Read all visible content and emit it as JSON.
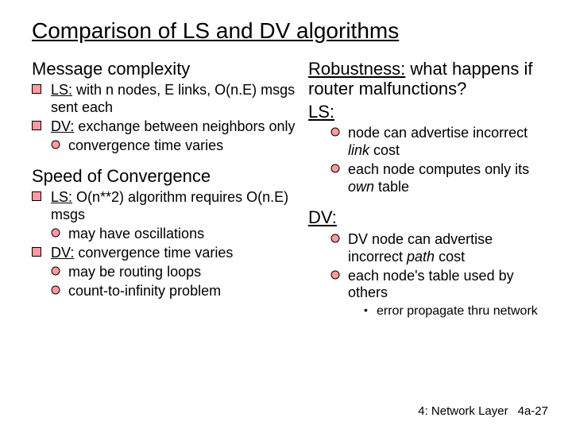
{
  "title": "Comparison of LS and DV algorithms",
  "left": {
    "h1": "Message complexity",
    "l1": {
      "prefix": "LS:",
      "rest": " with n nodes, E links, O(n.E) msgs sent each"
    },
    "l2": {
      "prefix": "DV:",
      "rest": " exchange between neighbors only"
    },
    "l2a": "convergence time varies",
    "h2": "Speed of Convergence",
    "l3": {
      "prefix": "LS:",
      "rest": " O(n**2) algorithm requires O(n.E) msgs"
    },
    "l3a": "may have oscillations",
    "l4": {
      "prefix": "DV:",
      "rest": " convergence time varies"
    },
    "l4a": "may be routing loops",
    "l4b": "count-to-infinity problem"
  },
  "right": {
    "h1a": "Robustness:",
    "h1b": " what happens if router malfunctions?",
    "ls_label": "LS:",
    "ls1a": "node can advertise incorrect ",
    "ls1b": "link",
    "ls1c": " cost",
    "ls2a": "each node computes only its ",
    "ls2b": "own",
    "ls2c": " table",
    "dv_label": "DV:",
    "dv1a": "DV node can advertise incorrect ",
    "dv1b": "path",
    "dv1c": " cost",
    "dv2": "each node's table used by others",
    "dv2a": "error propagate thru network"
  },
  "footer": {
    "label": "4: Network Layer",
    "page": "4a-27"
  }
}
